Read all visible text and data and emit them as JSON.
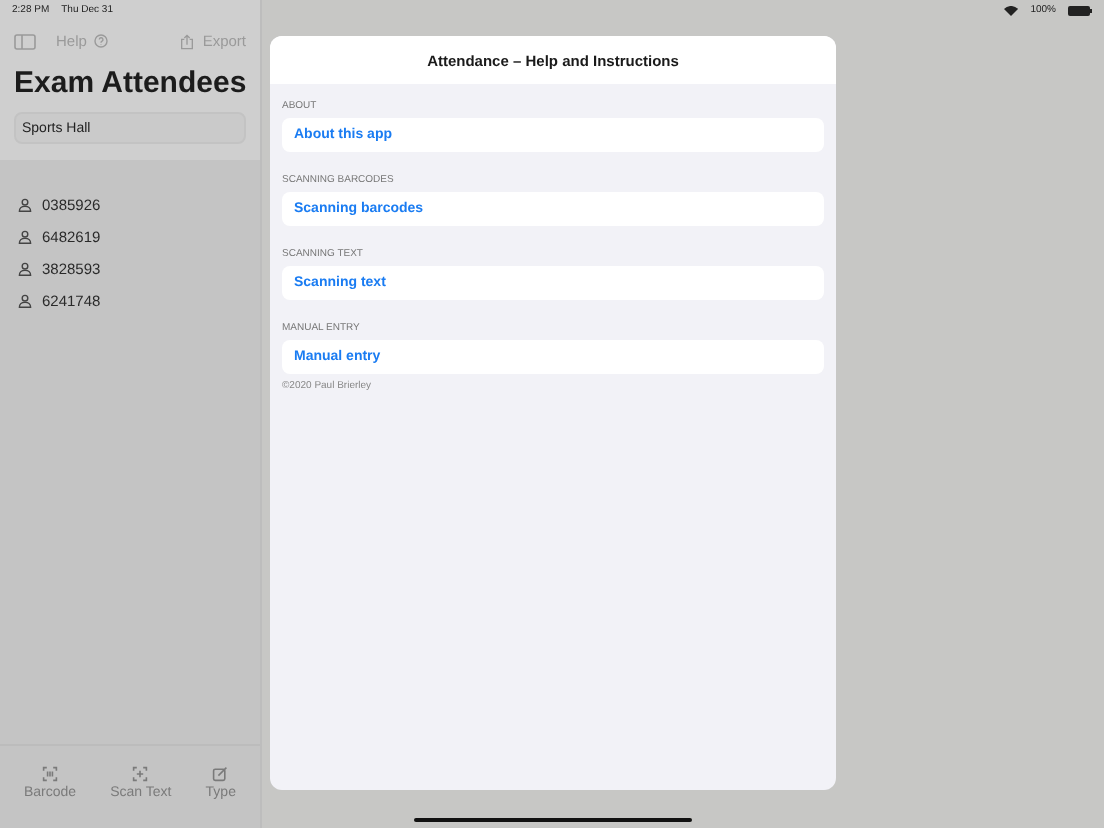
{
  "status_bar": {
    "time": "2:28 PM",
    "date": "Thu Dec 31",
    "battery": "100%"
  },
  "sidebar": {
    "toolbar": {
      "help": "Help",
      "export": "Export"
    },
    "title": "Exam Attendees",
    "location_field": {
      "value": "Sports Hall"
    },
    "attendees": [
      "0385926",
      "6482619",
      "3828593",
      "6241748"
    ],
    "tab_bar": [
      {
        "label": "Barcode",
        "kind": "barcode"
      },
      {
        "label": "Scan Text",
        "kind": "scan"
      },
      {
        "label": "Type",
        "kind": "type"
      }
    ]
  },
  "help_sheet": {
    "title": "Attendance – Help and Instructions",
    "sections": [
      {
        "header": "ABOUT",
        "item": "About this app"
      },
      {
        "header": "SCANNING BARCODES",
        "item": "Scanning barcodes"
      },
      {
        "header": "SCANNING TEXT",
        "item": "Scanning text"
      },
      {
        "header": "MANUAL ENTRY",
        "item": "Manual entry"
      }
    ],
    "footer": "©2020 Paul Brierley"
  }
}
